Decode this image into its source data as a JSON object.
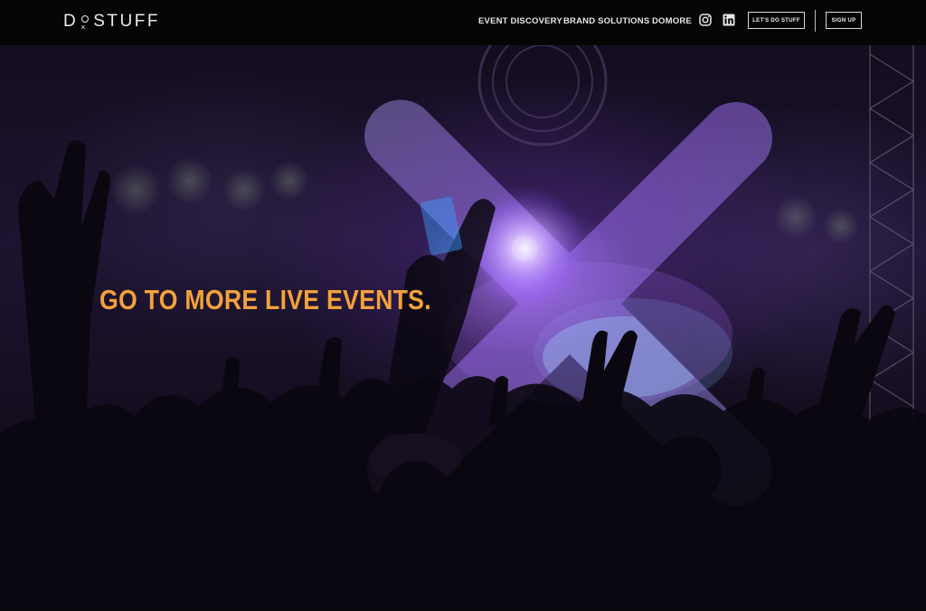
{
  "nav": {
    "logo_left": "D",
    "logo_right": "STUFF",
    "links": [
      "EVENT DISCOVERY",
      "BRAND SOLUTIONS",
      "DOMORE"
    ],
    "lets_do_stuff": "LET'S DO STUFF",
    "sign_up": "SIGN UP",
    "social_icons": [
      "instagram-icon",
      "linkedin-icon"
    ]
  },
  "hero": {
    "headline": "GO TO MORE LIVE EVENTS.",
    "accent_color": "#f2a23a",
    "background": "concert crowd with purple stage lights",
    "logo_mark": "x-mark"
  },
  "colors": {
    "nav_bg": "#050505",
    "headline": "#f2a23a",
    "stage_light": "#b98cff"
  }
}
